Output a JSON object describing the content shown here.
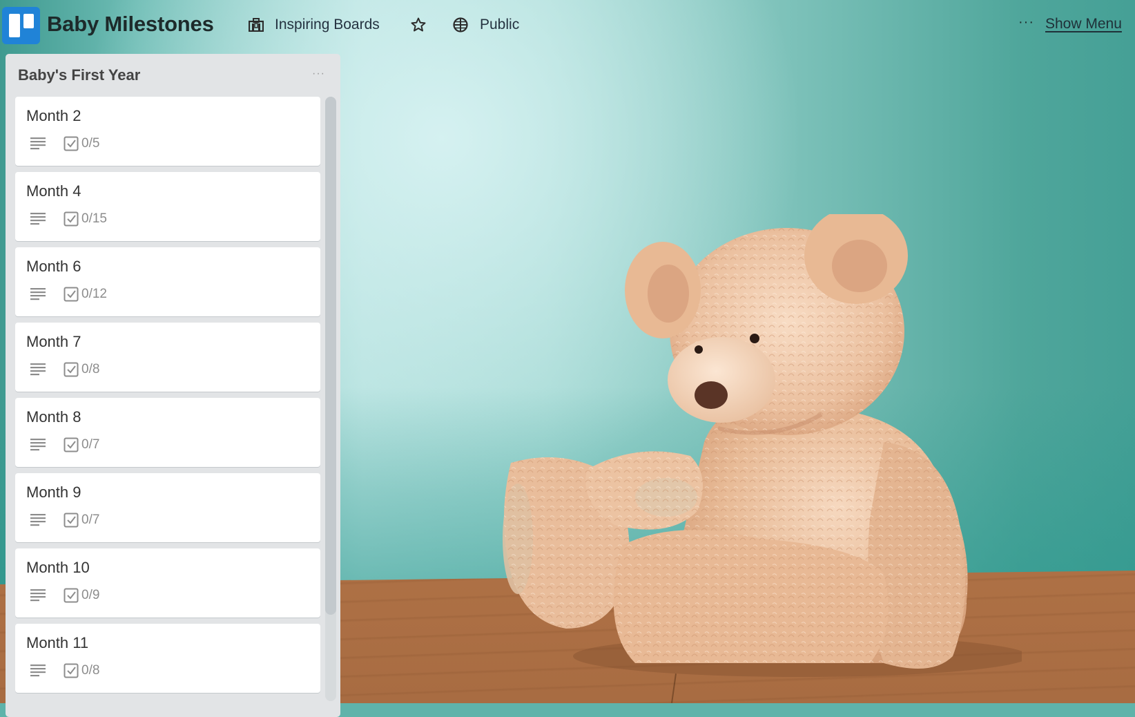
{
  "header": {
    "board_title": "Baby Milestones",
    "logo_icon": "trello-logo-icon",
    "organization": {
      "label": "Inspiring Boards",
      "icon": "briefcase-icon"
    },
    "star": {
      "icon": "star-icon",
      "starred": false
    },
    "visibility": {
      "label": "Public",
      "icon": "globe-icon"
    },
    "more_label": "···",
    "show_menu_label": "Show Menu"
  },
  "list": {
    "title": "Baby's First Year",
    "menu_label": "···",
    "cards": [
      {
        "title": "Month 2",
        "has_description": true,
        "checklist": "0/5"
      },
      {
        "title": "Month 4",
        "has_description": true,
        "checklist": "0/15"
      },
      {
        "title": "Month 6",
        "has_description": true,
        "checklist": "0/12"
      },
      {
        "title": "Month 7",
        "has_description": true,
        "checklist": "0/8"
      },
      {
        "title": "Month 8",
        "has_description": true,
        "checklist": "0/7"
      },
      {
        "title": "Month 9",
        "has_description": true,
        "checklist": "0/7"
      },
      {
        "title": "Month 10",
        "has_description": true,
        "checklist": "0/9"
      },
      {
        "title": "Month 11",
        "has_description": true,
        "checklist": "0/8"
      }
    ]
  },
  "background": {
    "description": "Teddy bear sitting on wooden floor against teal wall",
    "wall_color": "#8fcfc8",
    "floor_color": "#c08457",
    "bear_color": "#ecc3a2"
  },
  "colors": {
    "logo_blue": "#2083d7",
    "list_bg": "#e2e4e6",
    "card_bg": "#ffffff",
    "badge_gray": "#8c8c8c"
  }
}
